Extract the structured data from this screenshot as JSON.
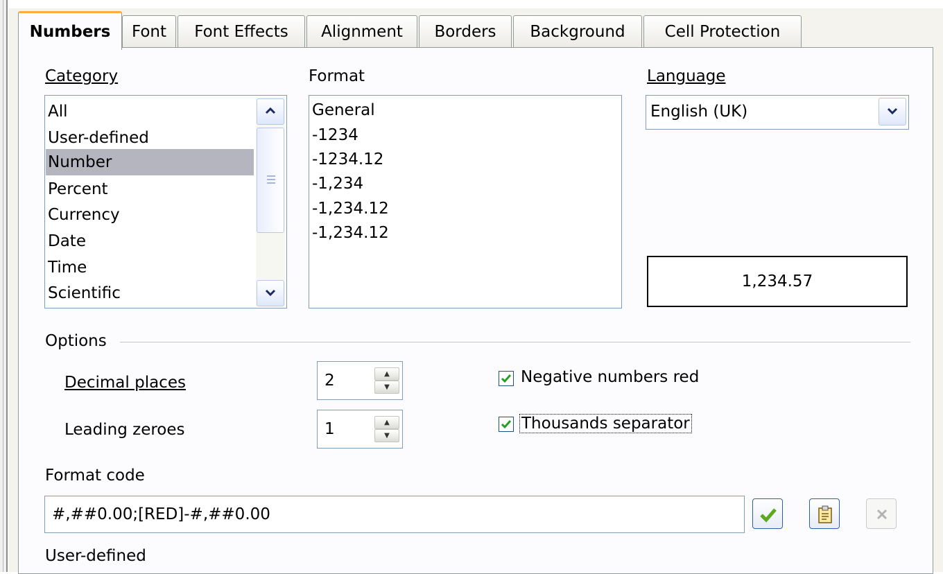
{
  "tabs": [
    "Numbers",
    "Font",
    "Font Effects",
    "Alignment",
    "Borders",
    "Background",
    "Cell Protection"
  ],
  "category": {
    "label": "Category",
    "items": [
      "All",
      "User-defined",
      "Number",
      "Percent",
      "Currency",
      "Date",
      "Time",
      "Scientific"
    ],
    "selected": "Number"
  },
  "format": {
    "label": "Format",
    "items": [
      "General",
      "-1234",
      "-1234.12",
      "-1,234",
      "-1,234.12",
      "-1,234.12"
    ]
  },
  "language": {
    "label": "Language",
    "value": "English (UK)"
  },
  "preview": {
    "value": "1,234.57"
  },
  "options": {
    "label": "Options",
    "decimal_places_label": "Decimal places",
    "decimal_places_value": "2",
    "leading_zeroes_label": "Leading zeroes",
    "leading_zeroes_value": "1",
    "negative_red_label": "Negative numbers red",
    "negative_red_checked": true,
    "thousands_sep_label": "Thousands separator",
    "thousands_sep_checked": true
  },
  "format_code": {
    "label": "Format code",
    "value": "#,##0.00;[RED]-#,##0.00"
  },
  "footer_text": "User-defined",
  "colors": {
    "active_tab_top": "#f9b03b",
    "selection": "#b5b5c0",
    "check": "#21a121"
  }
}
